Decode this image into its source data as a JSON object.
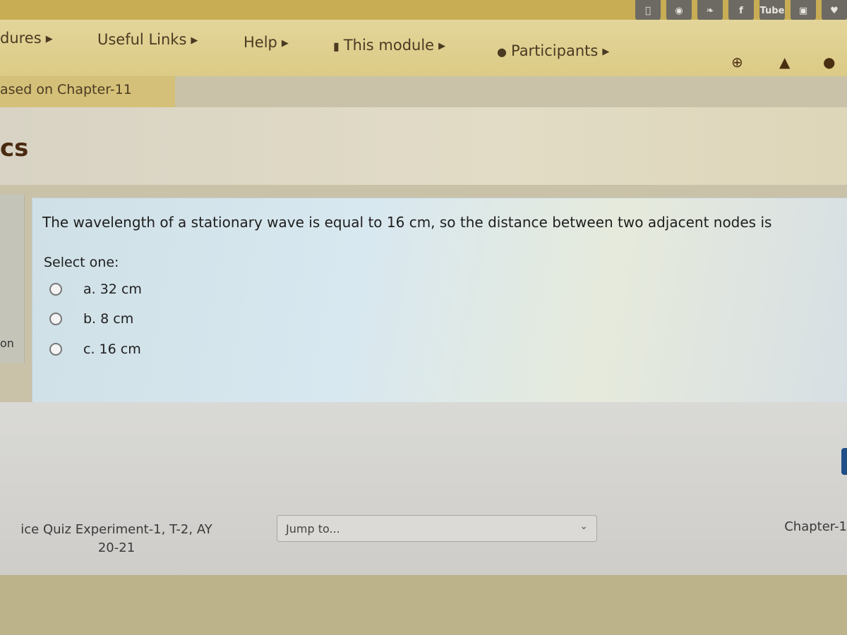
{
  "social_icons": [
    "apple-icon",
    "android-icon",
    "twitter-icon",
    "facebook-icon",
    "youtube-icon",
    "instagram-icon",
    "web-icon"
  ],
  "social_labels": {
    "youtube": "Tube",
    "facebook": "f"
  },
  "nav": {
    "items": [
      {
        "label": "dures"
      },
      {
        "label": "Useful Links"
      },
      {
        "label": "Help"
      },
      {
        "label": "This module"
      },
      {
        "label": "Participants"
      }
    ]
  },
  "breadcrumb": "ased on Chapter-11",
  "page_title": "cs",
  "left_stub": "on",
  "question": {
    "text": "The wavelength of a stationary wave is equal to 16 cm, so the distance between two adjacent nodes is",
    "select_label": "Select one:",
    "options": [
      {
        "label": "a. 32 cm",
        "selected": false
      },
      {
        "label": "b. 8 cm",
        "selected": false
      },
      {
        "label": "c. 16 cm",
        "selected": false
      }
    ]
  },
  "activity_nav": {
    "prev_line1": "ice Quiz Experiment-1, T-2, AY",
    "prev_line2": "20-21",
    "jump_placeholder": "Jump to...",
    "next": "Chapter-1"
  }
}
